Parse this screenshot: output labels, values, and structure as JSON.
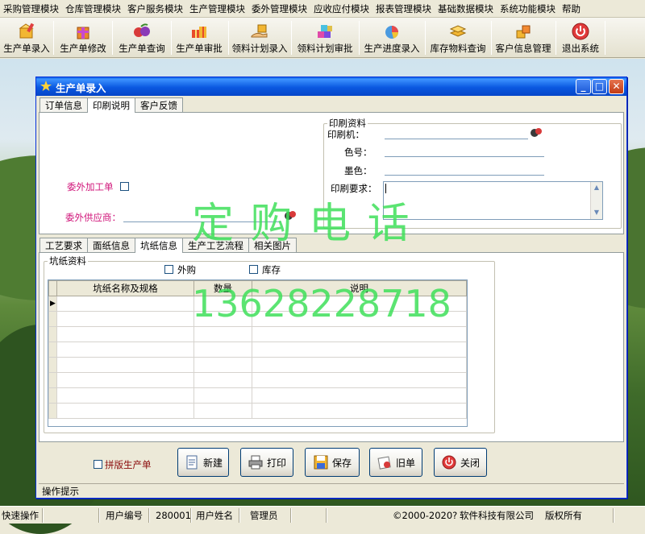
{
  "menu": [
    "采购管理模块",
    "仓库管理模块",
    "客户服务模块",
    "生产管理模块",
    "委外管理模块",
    "应收应付模块",
    "报表管理模块",
    "基础数据模块",
    "系统功能模块",
    "帮助"
  ],
  "toolbar": [
    "生产单录入",
    "生产单修改",
    "生产单查询",
    "生产单审批",
    "领料计划录入",
    "领料计划审批",
    "生产进度录入",
    "库存物料查询",
    "客户信息管理",
    "退出系统"
  ],
  "dialog": {
    "title": "生产单录入",
    "top_tabs": [
      "订单信息",
      "印刷说明",
      "客户反馈"
    ],
    "outsource_label": "委外加工单",
    "supplier_label": "委外供应商：",
    "print_group": {
      "legend": "印刷资料",
      "press_label": "印刷机：",
      "color_no_label": "色号：",
      "ink_color_label": "墨色：",
      "requirement_label": "印刷要求："
    },
    "bottom_tabs": [
      "工艺要求",
      "面纸信息",
      "坑纸信息",
      "生产工艺流程",
      "相关图片"
    ],
    "corrugated_group": {
      "legend": "坑纸资料",
      "outsourced_label": "外购",
      "stock_label": "库存",
      "columns": [
        "坑纸名称及规格",
        "数量",
        "说明"
      ]
    },
    "batch_label": "拼版生产单",
    "buttons": {
      "new": "新建",
      "print": "打印",
      "save": "保存",
      "old": "旧单",
      "close": "关闭"
    },
    "hint_label": "操作提示"
  },
  "watermark": {
    "line1": "定 购 电 话",
    "line2": "13628228718"
  },
  "statusbar": {
    "quick_ops": "快速操作",
    "user_id_label": "用户编号",
    "user_id": "280001",
    "user_name_label": "用户姓名",
    "user_name": "管理员",
    "copyright": "©2000-2020?",
    "company": "软件科技有限公司",
    "rights": "版权所有"
  }
}
